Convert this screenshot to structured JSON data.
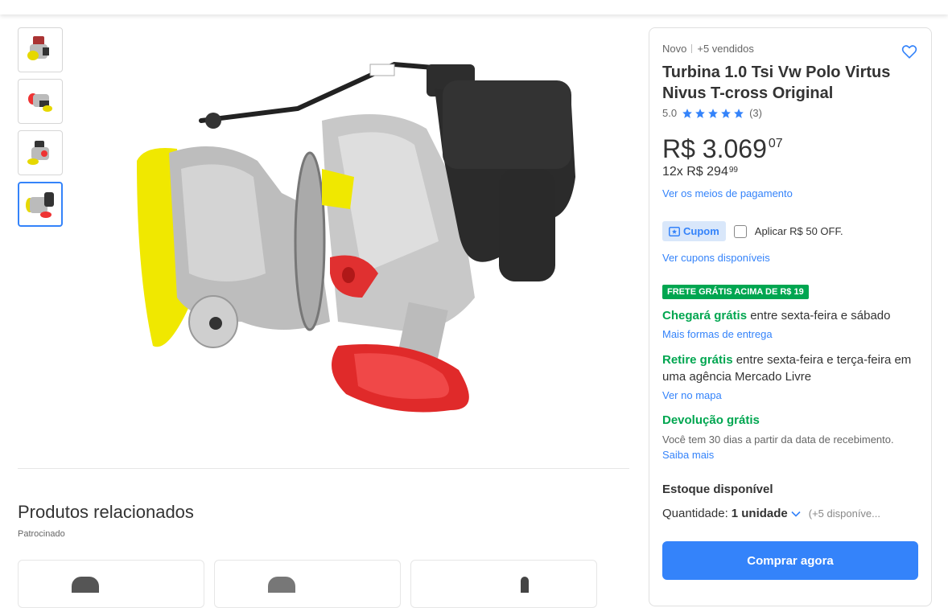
{
  "gallery": {
    "thumbnails": [
      "thumb-1",
      "thumb-2",
      "thumb-3",
      "thumb-4"
    ],
    "active_index": 3
  },
  "related": {
    "title": "Produtos relacionados",
    "sponsored": "Patrocinado"
  },
  "product": {
    "condition": "Novo",
    "sold": "+5 vendidos",
    "title": "Turbina 1.0 Tsi Vw Polo Virtus Nivus T-cross Original",
    "rating_value": "5.0",
    "rating_count": "(3)",
    "stars": 5,
    "price_main": "R$ 3.069",
    "price_cents": "07",
    "installments_main": "12x R$ 294",
    "installments_cents": "99",
    "payment_link": "Ver os meios de pagamento"
  },
  "coupon": {
    "tag": "Cupom",
    "apply_label": "Aplicar R$ 50 OFF.",
    "link": "Ver cupons disponíveis"
  },
  "shipping": {
    "badge": "FRETE GRÁTIS ACIMA DE R$ 19",
    "arrival_green": "Chegará grátis",
    "arrival_rest": " entre sexta-feira e sábado",
    "more_delivery": "Mais formas de entrega",
    "pickup_green": "Retire grátis",
    "pickup_rest": " entre sexta-feira e terça-feira em uma agência Mercado Livre",
    "map_link": "Ver no mapa",
    "return_title": "Devolução grátis",
    "return_text": "Você tem 30 dias a partir da data de recebimento.",
    "return_link": "Saiba mais"
  },
  "purchase": {
    "stock": "Estoque disponível",
    "qty_label": "Quantidade: ",
    "qty_value": "1 unidade",
    "qty_available": "(+5 disponíve...",
    "buy_button": "Comprar agora"
  },
  "colors": {
    "accent": "#3483fa",
    "green": "#00a650",
    "star": "#3483fa"
  }
}
